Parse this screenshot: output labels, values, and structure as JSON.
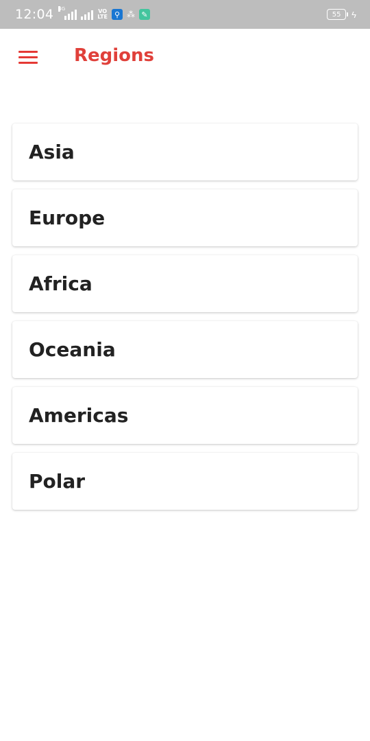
{
  "status_bar": {
    "time": "12:04",
    "network_tag": "4G",
    "volte_top": "VO",
    "volte_bottom": "LTE",
    "battery": "55",
    "icons": [
      "signal-4g-icon",
      "signal-icon",
      "volte-icon",
      "usb-icon",
      "share-icon",
      "cleaner-app-icon",
      "battery-icon",
      "charging-icon"
    ]
  },
  "header": {
    "title": "Regions",
    "menu_icon": "hamburger-menu-icon",
    "accent_color": "#e0403a"
  },
  "regions": [
    {
      "label": "Asia"
    },
    {
      "label": "Europe"
    },
    {
      "label": "Africa"
    },
    {
      "label": "Oceania"
    },
    {
      "label": "Americas"
    },
    {
      "label": "Polar"
    }
  ]
}
